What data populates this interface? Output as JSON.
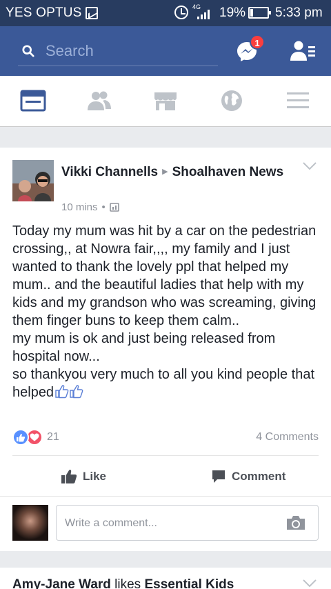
{
  "status_bar": {
    "carrier": "YES OPTUS",
    "network": "4G",
    "battery": "19%",
    "time": "5:33 pm"
  },
  "header": {
    "search_placeholder": "Search",
    "messenger_badge": "1",
    "icons": [
      "search-icon",
      "messenger-icon",
      "friend-requests-icon"
    ],
    "color": "#3b5998"
  },
  "tabs": [
    {
      "name": "news-feed",
      "icon": "news-feed-icon",
      "active": true
    },
    {
      "name": "friends",
      "icon": "friends-icon",
      "active": false
    },
    {
      "name": "marketplace",
      "icon": "marketplace-icon",
      "active": false
    },
    {
      "name": "notifications",
      "icon": "globe-icon",
      "active": false
    },
    {
      "name": "menu",
      "icon": "hamburger-icon",
      "active": false
    }
  ],
  "post": {
    "author": "Vikki Channells",
    "group": "Shoalhaven News",
    "time": "10 mins",
    "body": "Today my mum was hit by a car on the pedestrian crossing,, at Nowra fair,,,, my family and I just wanted to thank the lovely ppl that helped my mum.. and the beautiful ladies that help with my kids and my grandson who was screaming, giving them finger buns to keep them calm..\nmy mum is ok and just being released from hospital now...\nso thankyou very much to all you kind people that helped",
    "reactions_count": "21",
    "comments_count": "4 Comments",
    "like_label": "Like",
    "comment_label": "Comment",
    "comment_placeholder": "Write a comment..."
  },
  "next_post": {
    "actor": "Amy-Jane Ward",
    "verb": "likes",
    "object": "Essential Kids"
  }
}
